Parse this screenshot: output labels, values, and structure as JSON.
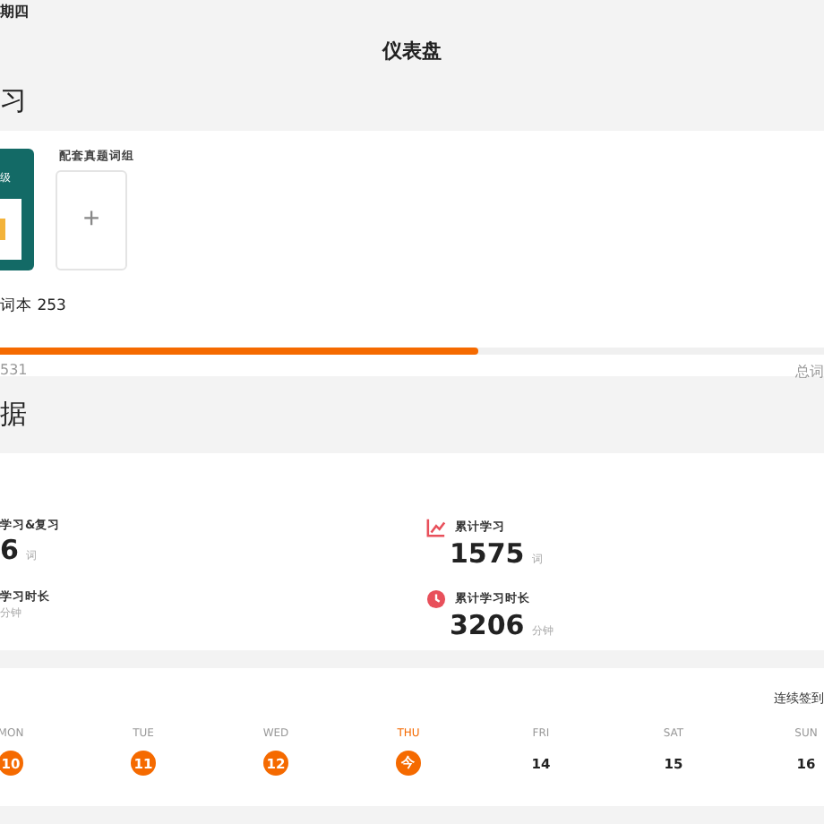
{
  "top_bar": {
    "date": "期四",
    "title": "仪表盘"
  },
  "study_section": {
    "heading": "习",
    "book": {
      "label": "级"
    },
    "add_card": {
      "label": "配套真题词组",
      "symbol": "+"
    },
    "wordbook": "词本 253",
    "progress": {
      "level": 0.58,
      "learned": "531",
      "total": "总词"
    }
  },
  "data_section": {
    "heading": "据",
    "stats": [
      {
        "label": "学习&复习",
        "value": "6",
        "unit": "词"
      },
      {
        "label": "累计学习",
        "value": "1575",
        "unit": "词"
      },
      {
        "label": "学习时长",
        "unit": "分钟"
      },
      {
        "label": "累计学习时长",
        "value": "3206",
        "unit": "分钟"
      }
    ]
  },
  "checkin": {
    "label": "连续签到",
    "days": [
      {
        "weekday": "MON",
        "date": "10",
        "signed": true,
        "today": false
      },
      {
        "weekday": "TUE",
        "date": "11",
        "signed": true,
        "today": false
      },
      {
        "weekday": "WED",
        "date": "12",
        "signed": true,
        "today": false
      },
      {
        "weekday": "THU",
        "date": "今",
        "signed": true,
        "today": true
      },
      {
        "weekday": "FRI",
        "date": "14",
        "signed": false,
        "today": false
      },
      {
        "weekday": "SAT",
        "date": "15",
        "signed": false,
        "today": false
      },
      {
        "weekday": "SUN",
        "date": "16",
        "signed": false,
        "today": false
      }
    ]
  }
}
